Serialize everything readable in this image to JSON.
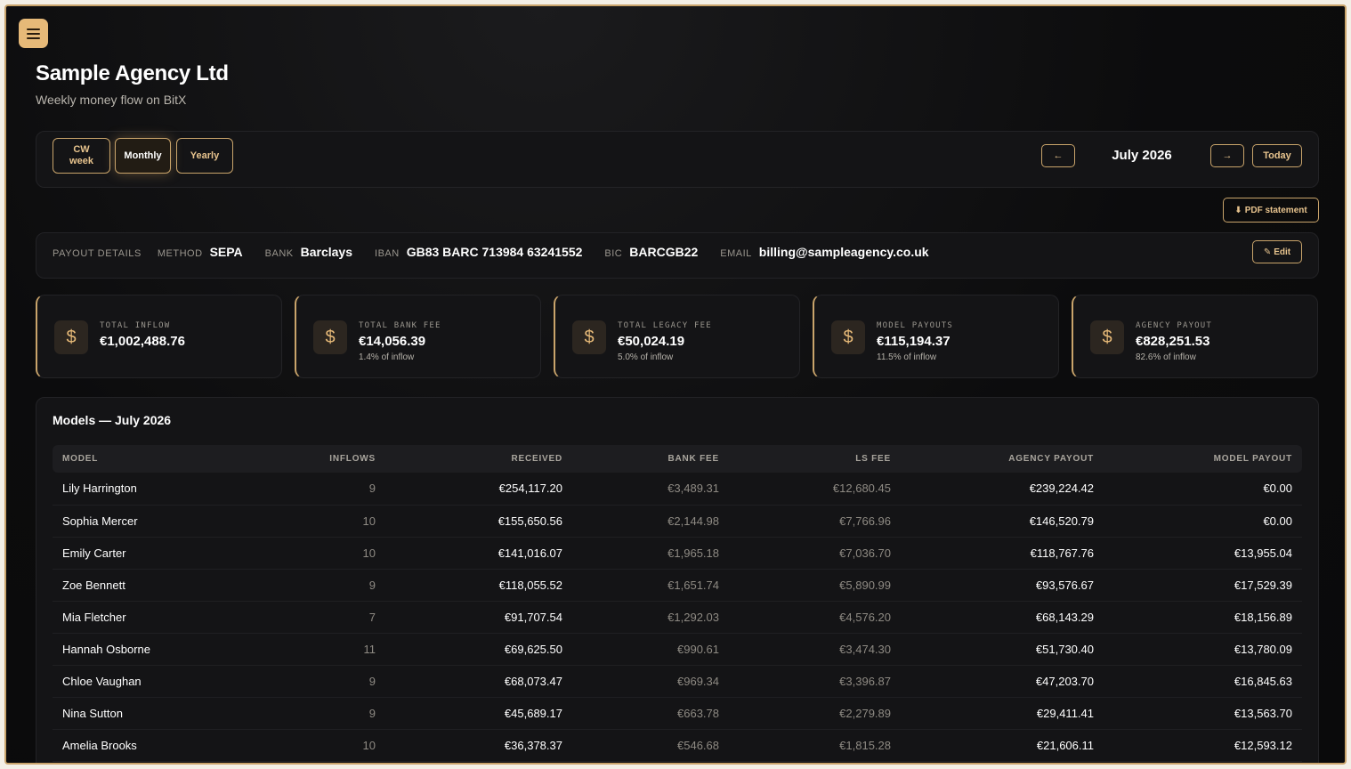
{
  "header": {
    "title": "Sample Agency Ltd",
    "subtitle": "Weekly money flow on BitX"
  },
  "period": {
    "cw_week_line1": "CW",
    "cw_week_line2": "week",
    "monthly": "Monthly",
    "yearly": "Yearly",
    "prev_icon": "←",
    "next_icon": "→",
    "current": "July 2026",
    "today": "Today",
    "active": "Monthly"
  },
  "actions": {
    "pdf_icon": "⬇",
    "pdf_label": "PDF statement",
    "edit_icon": "✎",
    "edit_label": "Edit"
  },
  "payout": {
    "heading": "PAYOUT DETAILS",
    "method_key": "METHOD",
    "method": "SEPA",
    "bank_key": "BANK",
    "bank": "Barclays",
    "iban_key": "IBAN",
    "iban": "GB83 BARC 713984 63241552",
    "bic_key": "BIC",
    "bic": "BARCGB22",
    "email_key": "EMAIL",
    "email": "billing@sampleagency.co.uk"
  },
  "kpis": [
    {
      "label": "TOTAL INFLOW",
      "value": "€1,002,488.76",
      "sub": ""
    },
    {
      "label": "TOTAL BANK FEE",
      "value": "€14,056.39",
      "sub": "1.4% of inflow"
    },
    {
      "label": "TOTAL LEGACY FEE",
      "value": "€50,024.19",
      "sub": "5.0% of inflow"
    },
    {
      "label": "MODEL PAYOUTS",
      "value": "€115,194.37",
      "sub": "11.5% of inflow"
    },
    {
      "label": "AGENCY PAYOUT",
      "value": "€828,251.53",
      "sub": "82.6% of inflow"
    }
  ],
  "kpi_icon": "$",
  "table": {
    "title": "Models — July 2026",
    "headers": [
      "MODEL",
      "INFLOWS",
      "RECEIVED",
      "BANK FEE",
      "LS FEE",
      "AGENCY PAYOUT",
      "MODEL PAYOUT"
    ],
    "rows": [
      [
        "Lily Harrington",
        "9",
        "€254,117.20",
        "€3,489.31",
        "€12,680.45",
        "€239,224.42",
        "€0.00"
      ],
      [
        "Sophia Mercer",
        "10",
        "€155,650.56",
        "€2,144.98",
        "€7,766.96",
        "€146,520.79",
        "€0.00"
      ],
      [
        "Emily Carter",
        "10",
        "€141,016.07",
        "€1,965.18",
        "€7,036.70",
        "€118,767.76",
        "€13,955.04"
      ],
      [
        "Zoe Bennett",
        "9",
        "€118,055.52",
        "€1,651.74",
        "€5,890.99",
        "€93,576.67",
        "€17,529.39"
      ],
      [
        "Mia Fletcher",
        "7",
        "€91,707.54",
        "€1,292.03",
        "€4,576.20",
        "€68,143.29",
        "€18,156.89"
      ],
      [
        "Hannah Osborne",
        "11",
        "€69,625.50",
        "€990.61",
        "€3,474.30",
        "€51,730.40",
        "€13,780.09"
      ],
      [
        "Chloe Vaughan",
        "9",
        "€68,073.47",
        "€969.34",
        "€3,396.87",
        "€47,203.70",
        "€16,845.63"
      ],
      [
        "Nina Sutton",
        "9",
        "€45,689.17",
        "€663.78",
        "€2,279.89",
        "€29,411.41",
        "€13,563.70"
      ],
      [
        "Amelia Brooks",
        "10",
        "€36,378.37",
        "€546.68",
        "€1,815.28",
        "€21,606.11",
        "€12,593.12"
      ]
    ]
  },
  "colors": {
    "accent": "#c9a46b",
    "accent_fill": "#e6b978",
    "background": "#0c0c0d",
    "panel": "#141416"
  }
}
